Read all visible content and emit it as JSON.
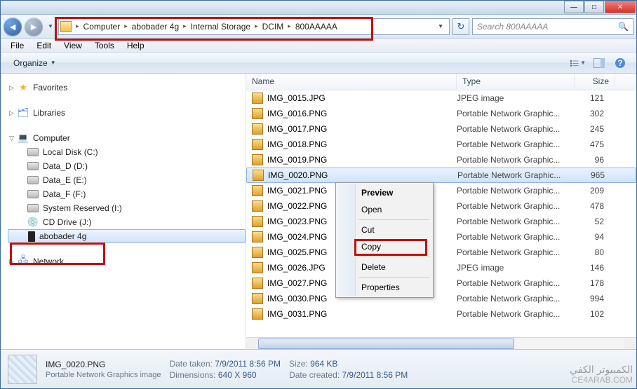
{
  "window": {
    "minimize": "—",
    "maximize": "□",
    "close": "✕"
  },
  "nav": {
    "back": "◄",
    "forward": "►",
    "refresh": "↻"
  },
  "breadcrumb": {
    "items": [
      "Computer",
      "abobader 4g",
      "Internal Storage",
      "DCIM",
      "800AAAAA"
    ]
  },
  "search": {
    "placeholder": "Search 800AAAAA"
  },
  "menu": {
    "items": [
      "File",
      "Edit",
      "View",
      "Tools",
      "Help"
    ]
  },
  "toolbar": {
    "organize": "Organize"
  },
  "tree": {
    "favorites": "Favorites",
    "libraries": "Libraries",
    "computer": "Computer",
    "drives": [
      "Local Disk (C:)",
      "Data_D (D:)",
      "Data_E (E:)",
      "Data_F (F:)",
      "System Reserved (I:)",
      "CD Drive (J:)"
    ],
    "phone": "abobader 4g",
    "network": "Network"
  },
  "columns": {
    "name": "Name",
    "type": "Type",
    "size": "Size"
  },
  "files": [
    {
      "name": "IMG_0015.JPG",
      "type": "JPEG image",
      "size": "121"
    },
    {
      "name": "IMG_0016.PNG",
      "type": "Portable Network Graphic...",
      "size": "302"
    },
    {
      "name": "IMG_0017.PNG",
      "type": "Portable Network Graphic...",
      "size": "245"
    },
    {
      "name": "IMG_0018.PNG",
      "type": "Portable Network Graphic...",
      "size": "475"
    },
    {
      "name": "IMG_0019.PNG",
      "type": "Portable Network Graphic...",
      "size": "96"
    },
    {
      "name": "IMG_0020.PNG",
      "type": "Portable Network Graphic...",
      "size": "965",
      "selected": true
    },
    {
      "name": "IMG_0021.PNG",
      "type": "Portable Network Graphic...",
      "size": "209"
    },
    {
      "name": "IMG_0022.PNG",
      "type": "Portable Network Graphic...",
      "size": "478"
    },
    {
      "name": "IMG_0023.PNG",
      "type": "Portable Network Graphic...",
      "size": "52"
    },
    {
      "name": "IMG_0024.PNG",
      "type": "Portable Network Graphic...",
      "size": "94"
    },
    {
      "name": "IMG_0025.PNG",
      "type": "Portable Network Graphic...",
      "size": "80"
    },
    {
      "name": "IMG_0026.JPG",
      "type": "JPEG image",
      "size": "146"
    },
    {
      "name": "IMG_0027.PNG",
      "type": "Portable Network Graphic...",
      "size": "178"
    },
    {
      "name": "IMG_0030.PNG",
      "type": "Portable Network Graphic...",
      "size": "994"
    },
    {
      "name": "IMG_0031.PNG",
      "type": "Portable Network Graphic...",
      "size": "102"
    }
  ],
  "context": {
    "preview": "Preview",
    "open": "Open",
    "cut": "Cut",
    "copy": "Copy",
    "delete": "Delete",
    "properties": "Properties"
  },
  "status": {
    "filename": "IMG_0020.PNG",
    "filetype": "Portable Network Graphics image",
    "datetaken_label": "Date taken:",
    "datetaken": "7/9/2011 8:56 PM",
    "dimensions_label": "Dimensions:",
    "dimensions": "640 X 960",
    "size_label": "Size:",
    "size": "964 KB",
    "datecreated_label": "Date created:",
    "datecreated": "7/9/2011 8:56 PM"
  },
  "watermark": {
    "ar": "الكمبيوتر الكفي",
    "en": "CE4ARAB.COM"
  }
}
